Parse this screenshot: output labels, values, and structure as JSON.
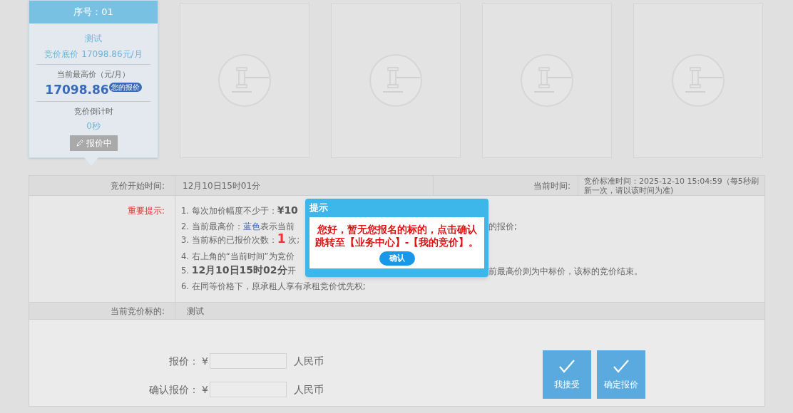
{
  "lots": [
    {
      "kind": "lot",
      "header": "序号：01",
      "name": "测试",
      "reserve": "竞价底价 17098.86元/月",
      "highest_label": "当前最高价（元/月）",
      "highest_price": "17098.86",
      "badge": "您的报价",
      "countdown_label": "竞价倒计时",
      "countdown": "0秒",
      "status_button": "报价中"
    },
    {
      "kind": "placeholder"
    },
    {
      "kind": "placeholder"
    },
    {
      "kind": "placeholder"
    },
    {
      "kind": "placeholder"
    }
  ],
  "info": {
    "start_label": "竞价开始时间:",
    "start_value": "12月10日15时01分",
    "now_label": "当前时间:",
    "now_value": "竞价标准时间：2025-12-10 15:04:59（每5秒刷新一次，请以该时间为准)",
    "notice_label": "重要提示:",
    "notice_lines": [
      {
        "head": [
          {
            "kind": "plain",
            "text": "1. 每次加价幅度不少于："
          },
          {
            "kind": "big",
            "text": "¥10"
          }
        ]
      },
      {
        "head": [
          {
            "kind": "plain",
            "text": "2. 当前最高价："
          },
          {
            "kind": "blue",
            "text": "蓝色"
          },
          {
            "kind": "plain",
            "text": "表示当前"
          }
        ],
        "tail": "的报价;"
      },
      {
        "head": [
          {
            "kind": "plain",
            "text": "3. 当前标的已报价次数："
          },
          {
            "kind": "red",
            "text": "1"
          },
          {
            "kind": "plain",
            "text": " 次;"
          }
        ]
      },
      {
        "head": [
          {
            "kind": "plain",
            "text": "4. 右上角的“当前时间”为竞价"
          }
        ]
      },
      {
        "head": [
          {
            "kind": "plain",
            "text": "5. "
          },
          {
            "kind": "big",
            "text": "12月10日15时02分"
          },
          {
            "kind": "plain",
            "text": "开"
          }
        ],
        "tail": "前最高价则为中标价，该标的竞价结束。"
      },
      {
        "head": [
          {
            "kind": "plain",
            "text": "6. 在同等价格下，原承租人享有承租竞价优先权;"
          }
        ]
      }
    ],
    "lot_label": "当前竞价标的:",
    "lot_value": "测试"
  },
  "form": {
    "fields": [
      {
        "label": "报价：",
        "currency": "¥",
        "unit": "人民币"
      },
      {
        "label": "确认报价：",
        "currency": "¥",
        "unit": "人民币"
      }
    ],
    "buttons": [
      "我接受",
      "确定报价"
    ]
  },
  "dialog": {
    "title": "提示",
    "message_lines": [
      "您好，暂无您报名的标的，点击确认",
      "跳转至【业务中心】-【我的竞价】。"
    ],
    "confirm": "确认"
  }
}
